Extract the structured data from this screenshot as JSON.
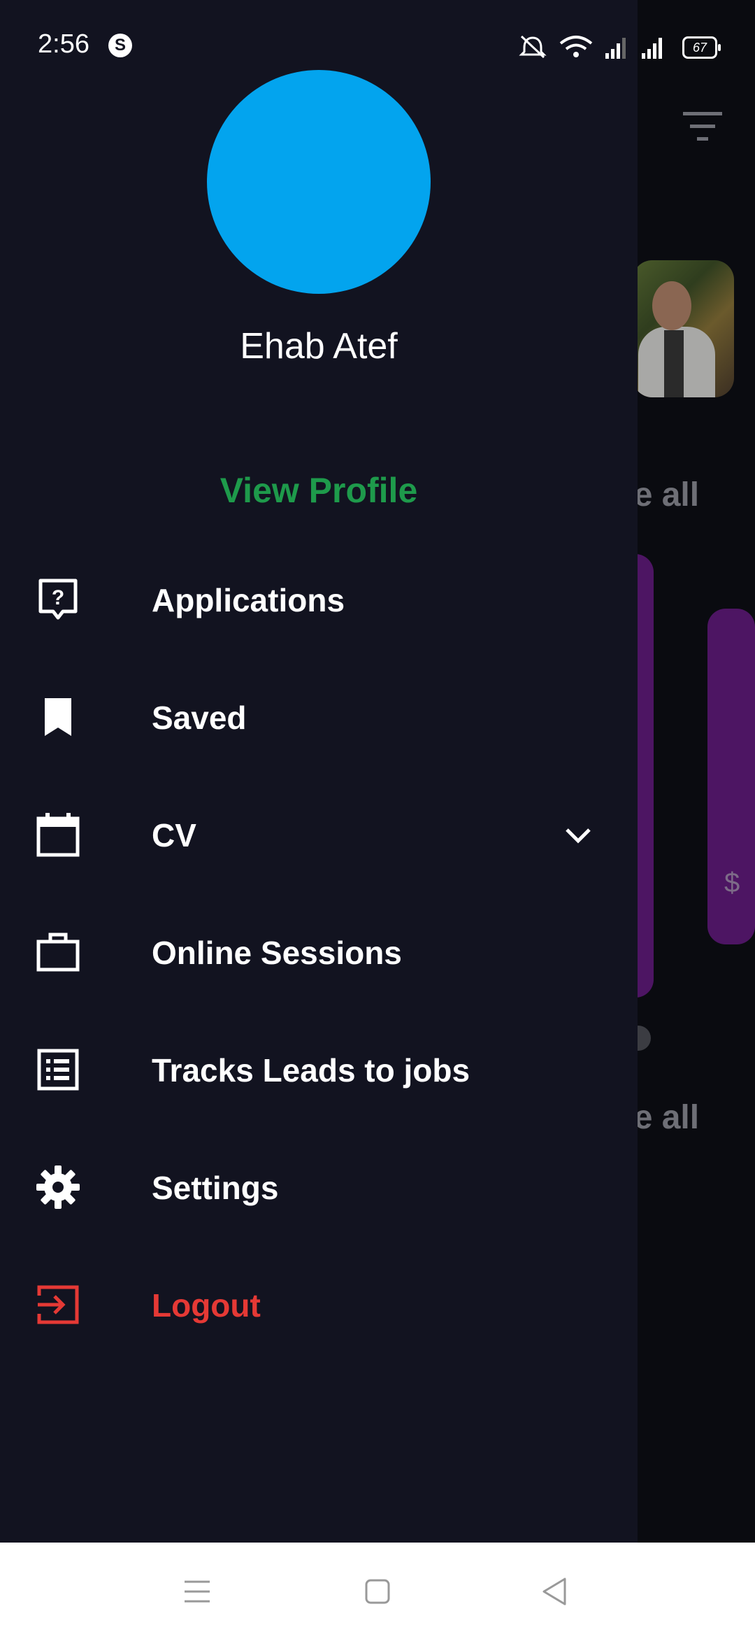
{
  "status_bar": {
    "time": "2:56",
    "app_badge": "S",
    "battery": "67",
    "icons": [
      "mute-icon",
      "wifi-icon",
      "signal-icon",
      "signal-icon"
    ]
  },
  "drawer": {
    "user_name": "Ehab Atef",
    "view_profile": "View Profile",
    "avatar_color": "#03a4ee",
    "accent_color": "#1e9a4b",
    "logout_color": "#e53935",
    "items": [
      {
        "label": "Applications",
        "icon": "question-doc-icon"
      },
      {
        "label": "Saved",
        "icon": "bookmark-icon"
      },
      {
        "label": "CV",
        "icon": "calendar-icon",
        "expandable": true
      },
      {
        "label": "Online Sessions",
        "icon": "briefcase-icon"
      },
      {
        "label": "Tracks Leads to jobs",
        "icon": "list-icon"
      },
      {
        "label": "Settings",
        "icon": "gear-icon"
      },
      {
        "label": "Logout",
        "icon": "logout-icon"
      }
    ]
  },
  "background": {
    "see_all_1": "ee all",
    "see_all_2": "ee all",
    "card_partial_text": "$"
  },
  "nav_bar": {
    "buttons": [
      "menu-icon",
      "home-icon",
      "back-icon"
    ]
  }
}
